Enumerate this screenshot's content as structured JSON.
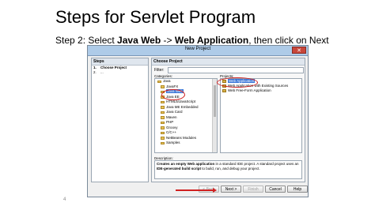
{
  "slide": {
    "title": "Steps for Servlet Program",
    "step_prefix": "Step 2: Select ",
    "step_bold1": "Java Web",
    "step_arrow": " -> ",
    "step_bold2": "Web Application",
    "step_suffix": ", then click on Next",
    "page_number": "4"
  },
  "dialog": {
    "title": "New Project",
    "close_glyph": "✕",
    "steps_header": "Steps",
    "steps": [
      {
        "num": "1.",
        "label": "Choose Project"
      },
      {
        "num": "2.",
        "label": "..."
      }
    ],
    "choose_header": "Choose Project",
    "filter_label": "Filter:",
    "filter_value": "",
    "categories_label": "Categories:",
    "projects_label": "Projects:",
    "categories": [
      "Java",
      "JavaFX",
      "Java Web",
      "Java EE",
      "HTML5/JavaScript",
      "Java ME Embedded",
      "Java Card",
      "Maven",
      "PHP",
      "Groovy",
      "C/C++",
      "NetBeans Modules",
      "Samples"
    ],
    "projects": [
      "Web Application",
      "Web Application with Existing Sources",
      "Web Free-Form Application"
    ],
    "description_label": "Description:",
    "description_bold1": "Creates an empty Web application",
    "description_text1": " in a standard IDE project. A standard project uses an ",
    "description_bold2": "IDE-generated build script",
    "description_text2": " to build, run, and debug your project.",
    "buttons": {
      "back": "< Back",
      "next": "Next >",
      "finish": "Finish",
      "cancel": "Cancel",
      "help": "Help"
    }
  }
}
